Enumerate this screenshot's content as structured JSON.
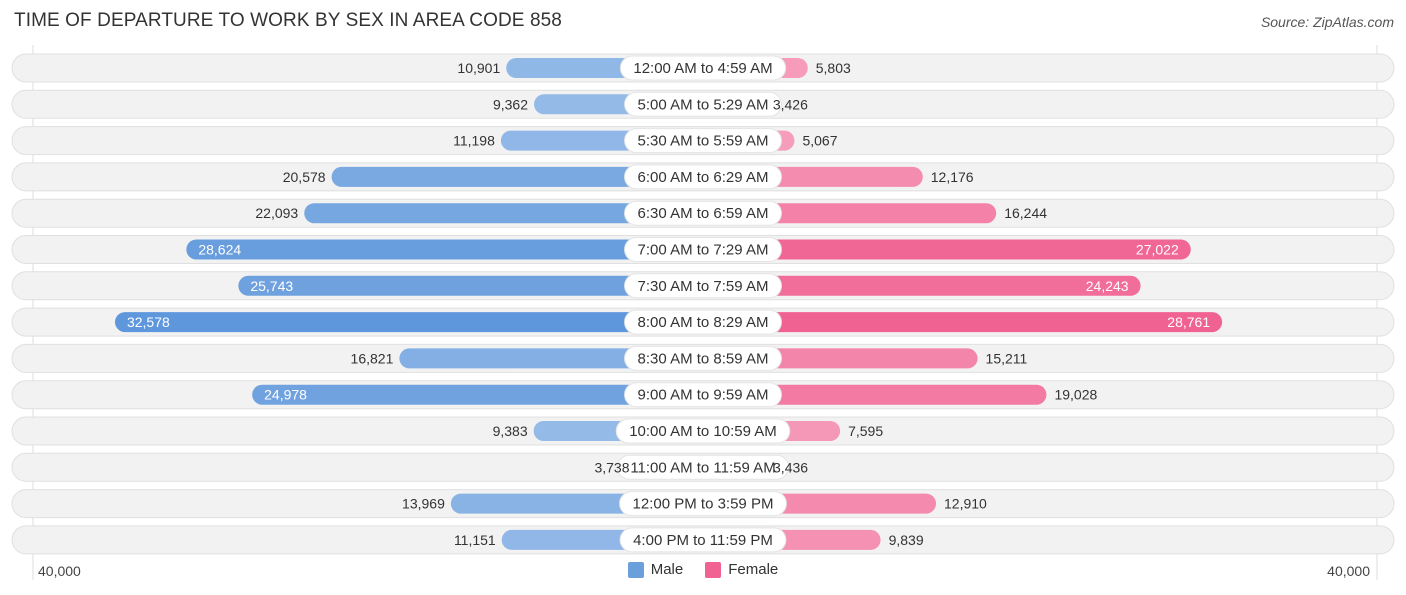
{
  "chart_data": {
    "type": "bar",
    "orientation": "horizontal-diverging",
    "title": "TIME OF DEPARTURE TO WORK BY SEX IN AREA CODE 858",
    "source": "Source: ZipAtlas.com",
    "categories": [
      "12:00 AM to 4:59 AM",
      "5:00 AM to 5:29 AM",
      "5:30 AM to 5:59 AM",
      "6:00 AM to 6:29 AM",
      "6:30 AM to 6:59 AM",
      "7:00 AM to 7:29 AM",
      "7:30 AM to 7:59 AM",
      "8:00 AM to 8:29 AM",
      "8:30 AM to 8:59 AM",
      "9:00 AM to 9:59 AM",
      "10:00 AM to 10:59 AM",
      "11:00 AM to 11:59 AM",
      "12:00 PM to 3:59 PM",
      "4:00 PM to 11:59 PM"
    ],
    "series": [
      {
        "name": "Male",
        "color": "#6a9fdc",
        "values": [
          10901,
          9362,
          11198,
          20578,
          22093,
          28624,
          25743,
          32578,
          16821,
          24978,
          9383,
          3738,
          13969,
          11151
        ]
      },
      {
        "name": "Female",
        "color": "#f06292",
        "values": [
          5803,
          3426,
          5067,
          12176,
          16244,
          27022,
          24243,
          28761,
          15211,
          19028,
          7595,
          3436,
          12910,
          9839
        ]
      }
    ],
    "value_labels": {
      "Male": [
        "10,901",
        "9,362",
        "11,198",
        "20,578",
        "22,093",
        "28,624",
        "25,743",
        "32,578",
        "16,821",
        "24,978",
        "9,383",
        "3,738",
        "13,969",
        "11,151"
      ],
      "Female": [
        "5,803",
        "3,426",
        "5,067",
        "12,176",
        "16,244",
        "27,022",
        "24,243",
        "28,761",
        "15,211",
        "19,028",
        "7,595",
        "3,436",
        "12,910",
        "9,839"
      ]
    },
    "xlim": [
      -40000,
      40000
    ],
    "axis_labels": {
      "left": "40,000",
      "right": "40,000"
    },
    "legend": {
      "position": "bottom-center",
      "entries": [
        "Male",
        "Female"
      ]
    },
    "grid": false
  }
}
